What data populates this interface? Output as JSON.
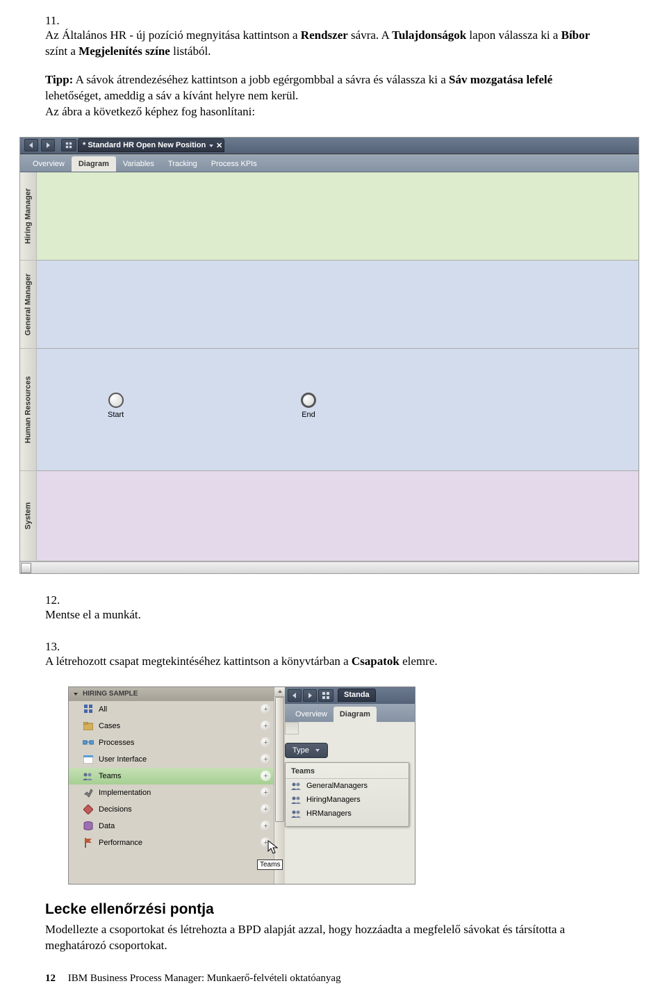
{
  "step11": {
    "num": "11.",
    "text_parts": [
      "Az Általános HR - új pozíció megnyitása kattintson a ",
      "Rendszer",
      " sávra. A ",
      "Tulajdonságok",
      " lapon válassza ki a ",
      "Bíbor",
      " színt a ",
      "Megjelenítés színe",
      " listából."
    ],
    "tip_parts": [
      "Tipp:",
      "  A sávok átrendezéséhez kattintson a jobb egérgombbal a sávra és válassza ki a ",
      "Sáv mozgatása lefelé",
      " lehetőséget, ameddig a sáv a kívánt helyre nem kerül."
    ],
    "tip_line2": "Az ábra a következő képhez fog hasonlítani:"
  },
  "step12": {
    "num": "12.",
    "text": "Mentse el a munkát."
  },
  "step13": {
    "num": "13.",
    "text_parts": [
      "A létrehozott csapat megtekintéséhez kattintson a könyvtárban a ",
      "Csapatok",
      " elemre."
    ]
  },
  "section_title": "Lecke ellenőrzési pontja",
  "section_para": "Modellezte a csoportokat és létrehozta a BPD alapját azzal, hogy hozzáadta a megfelelő sávokat és társította a meghatározó csoportokat.",
  "footer": {
    "num": "12",
    "text": "IBM Business Process Manager: Munkaerő-felvételi oktatóanyag"
  },
  "fig1": {
    "title": "* Standard HR Open New Position",
    "tabs": [
      "Overview",
      "Diagram",
      "Variables",
      "Tracking",
      "Process KPIs"
    ],
    "active_tab": 1,
    "lanes": [
      {
        "label": "Hiring Manager",
        "color": "green"
      },
      {
        "label": "General Manager",
        "color": "blue1"
      },
      {
        "label": "Human Resources",
        "color": "blue2"
      },
      {
        "label": "System",
        "color": "purple"
      }
    ],
    "nodes": {
      "start": "Start",
      "end": "End"
    }
  },
  "fig2": {
    "header": "HIRING SAMPLE",
    "items": [
      {
        "icon": "grid",
        "label": "All"
      },
      {
        "icon": "cases",
        "label": "Cases"
      },
      {
        "icon": "processes",
        "label": "Processes"
      },
      {
        "icon": "ui",
        "label": "User Interface"
      },
      {
        "icon": "teams",
        "label": "Teams",
        "selected": true
      },
      {
        "icon": "impl",
        "label": "Implementation"
      },
      {
        "icon": "decisions",
        "label": "Decisions"
      },
      {
        "icon": "data",
        "label": "Data"
      },
      {
        "icon": "perf",
        "label": "Performance"
      }
    ],
    "tooltip": "Teams",
    "right_title": "Standa",
    "right_tabs": [
      "Overview",
      "Diagram"
    ],
    "right_active_tab": 1,
    "type_label": "Type",
    "teams_panel": {
      "header": "Teams",
      "items": [
        "GeneralManagers",
        "HiringManagers",
        "HRManagers"
      ]
    }
  }
}
